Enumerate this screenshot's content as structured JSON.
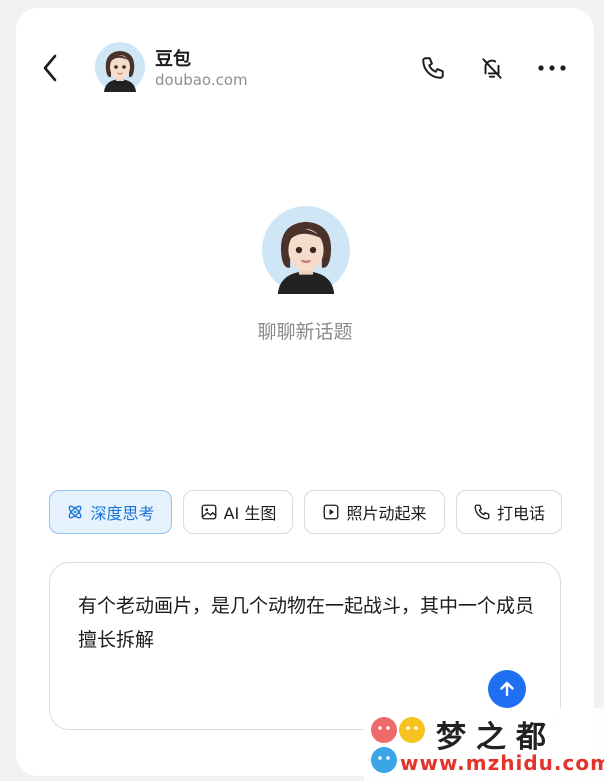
{
  "header": {
    "name": "豆包",
    "subtitle": "doubao.com",
    "icons": [
      "chevron-left-icon",
      "avatar",
      "phone-icon",
      "bell-mute-icon",
      "more-icon"
    ]
  },
  "center": {
    "title": "聊聊新话题"
  },
  "chips": [
    {
      "label": "深度思考",
      "icon": "atom-icon",
      "active": true
    },
    {
      "label": "AI 生图",
      "icon": "image-icon",
      "active": false
    },
    {
      "label": "照片动起来",
      "icon": "play-icon",
      "active": false
    },
    {
      "label": "打电话",
      "icon": "phone-icon",
      "active": false
    }
  ],
  "input": {
    "text": "有个老动画片，是几个动物在一起战斗，其中一个成员擅长拆解"
  },
  "watermark": {
    "text": "梦之都",
    "url": "www.mzhidu.com"
  },
  "colors": {
    "accent": "#1e6ff2",
    "chip_active_bg": "#e6f2fd",
    "chip_active_text": "#1a73d9"
  }
}
